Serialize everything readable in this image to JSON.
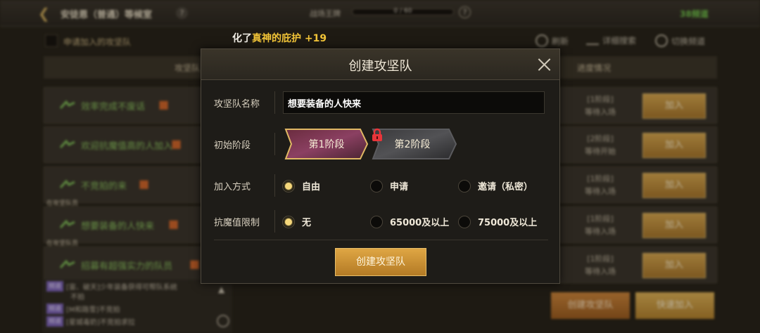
{
  "top_bar": {
    "room_title": "安徒恩（普通）等候室",
    "battle_label": "战场王牌",
    "progress_text": "0 / 60",
    "progress_fraction": 0,
    "channel": "38频道"
  },
  "sub_bar": {
    "apply_checkbox_label": "申请加入的攻坚队",
    "refresh_label": "刷新",
    "detail_search_label": "详细搜索",
    "switch_channel_label": "切换频道"
  },
  "columns": {
    "team_col": "攻坚队",
    "progress_col": "进度情况"
  },
  "notify": {
    "prefix": "化了",
    "highlight": "真神的庇护 +19"
  },
  "teams": [
    {
      "name": "效率完成不废话",
      "stage": "[1阶段]",
      "state": "等待入场",
      "join": "加入",
      "leader_tag": ""
    },
    {
      "name": "欢迎抗魔值高的人加入",
      "stage": "[2阶段]",
      "state": "等待开始",
      "join": "加入",
      "leader_tag": ""
    },
    {
      "name": "不竞拍的来",
      "stage": "[1阶段]",
      "state": "等待入场",
      "join": "加入",
      "leader_tag": ""
    },
    {
      "name": "想要装备的人快来",
      "stage": "[1阶段]",
      "state": "等待入场",
      "join": "加入",
      "leader_tag": "在攻坚队员"
    },
    {
      "name": "招募有超强实力的队员",
      "stage": "[1阶段]",
      "state": "等待入场",
      "join": "加入",
      "leader_tag": "在攻坚队员"
    }
  ],
  "chat": [
    {
      "channel": "频道",
      "text": "[宙、破天]少年装备获得可帮队系统"
    },
    {
      "channel": "",
      "text": "不拍"
    },
    {
      "channel": "频道",
      "text": "[M和路雪]不竞拍"
    },
    {
      "channel": "频道",
      "text": "[星城毒奶]不竞拍求拉"
    }
  ],
  "bottom": {
    "create_label": "创建攻坚队",
    "quick_join_label": "快速加入"
  },
  "modal": {
    "title": "创建攻坚队",
    "name_label": "攻坚队名称",
    "name_value": "想要装备的人快来",
    "stage_label": "初始阶段",
    "stage1": "第1阶段",
    "stage2": "第2阶段",
    "join_label": "加入方式",
    "join_options": [
      "自由",
      "申请",
      "邀请（私密）"
    ],
    "join_selected": 0,
    "limit_label": "抗魔值限制",
    "limit_options": [
      "无",
      "65000及以上",
      "75000及以上"
    ],
    "limit_selected": 0,
    "submit_label": "创建攻坚队",
    "accent_color": "#d9a243",
    "radio_on_color": "#f5d77b"
  }
}
